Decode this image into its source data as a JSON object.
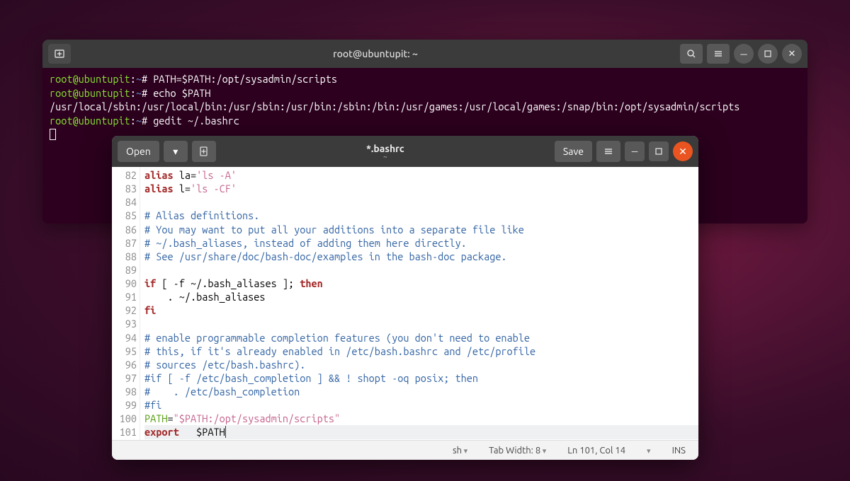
{
  "terminal": {
    "title": "root@ubuntupit: ~",
    "prompt_user": "root@ubuntupit",
    "prompt_path": "~",
    "prompt_symbol": "#",
    "lines": {
      "cmd1": "PATH=$PATH:/opt/sysadmin/scripts",
      "cmd2": "echo $PATH",
      "output1": "/usr/local/sbin:/usr/local/bin:/usr/sbin:/usr/bin:/sbin:/bin:/usr/games:/usr/local/games:/snap/bin:/opt/sysadmin/scripts",
      "cmd3": "gedit ~/.bashrc"
    }
  },
  "gedit": {
    "open_label": "Open",
    "save_label": "Save",
    "title": "*.bashrc",
    "subtitle": "~",
    "statusbar": {
      "lang": "sh",
      "tabwidth": "Tab Width: 8",
      "position": "Ln 101, Col 14",
      "ins": "INS"
    },
    "gutter": [
      "82",
      "83",
      "84",
      "85",
      "86",
      "87",
      "88",
      "89",
      "90",
      "91",
      "92",
      "93",
      "94",
      "95",
      "96",
      "97",
      "98",
      "99",
      "100",
      "101"
    ],
    "code": {
      "l82a": "alias",
      "l82b": " la=",
      "l82c": "'ls -A'",
      "l83a": "alias",
      "l83b": " l=",
      "l83c": "'ls -CF'",
      "l84": "",
      "l85": "# Alias definitions.",
      "l86": "# You may want to put all your additions into a separate file like",
      "l87": "# ~/.bash_aliases, instead of adding them here directly.",
      "l88": "# See /usr/share/doc/bash-doc/examples in the bash-doc package.",
      "l89": "",
      "l90a": "if",
      "l90b": " [ -f ~/.bash_aliases ]; ",
      "l90c": "then",
      "l91": "    . ~/.bash_aliases",
      "l92": "fi",
      "l93": "",
      "l94": "# enable programmable completion features (you don't need to enable",
      "l95": "# this, if it's already enabled in /etc/bash.bashrc and /etc/profile",
      "l96": "# sources /etc/bash.bashrc).",
      "l97": "#if [ -f /etc/bash_completion ] && ! shopt -oq posix; then",
      "l98": "#    . /etc/bash_completion",
      "l99": "#fi",
      "l100a": "PATH",
      "l100b": "=",
      "l100c": "\"$PATH:/opt/sysadmin/scripts\"",
      "l101a": "export",
      "l101b": "   $PATH"
    }
  }
}
